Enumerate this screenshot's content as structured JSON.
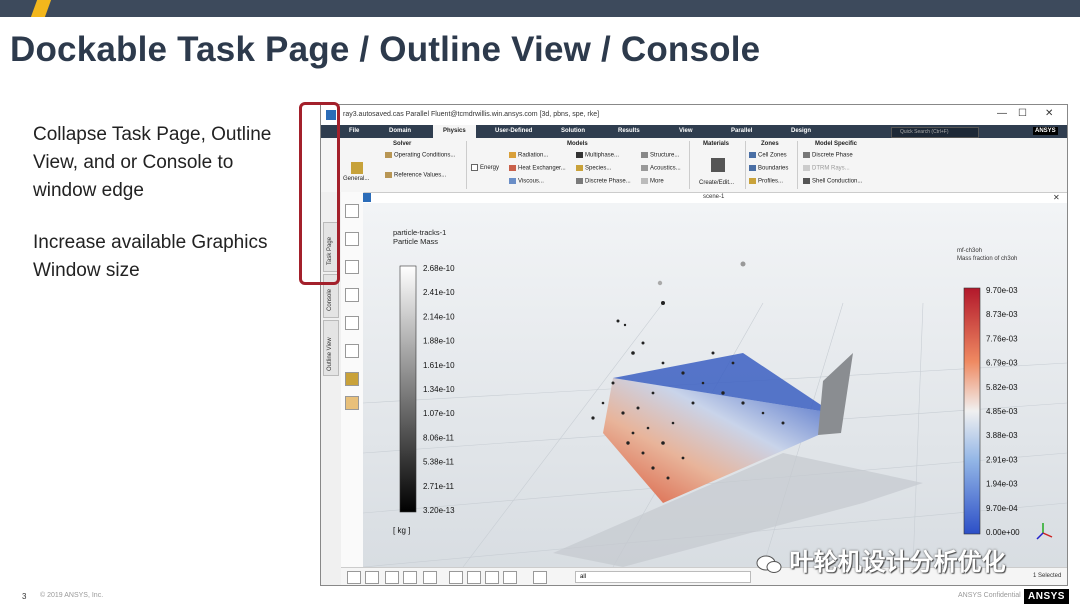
{
  "slide": {
    "title": "Dockable Task Page / Outline View / Console",
    "bullets": [
      "Collapse Task Page, Outline View, and or Console to window edge",
      "Increase available Graphics Window size"
    ],
    "page_number": "3",
    "copyright": "© 2019 ANSYS, Inc.",
    "confidential": "ANSYS Confidential",
    "logo_text": "ANSYS",
    "watermark": "叶轮机设计分析优化"
  },
  "window": {
    "title": "ray3.autosaved.cas Parallel Fluent@tcmdrwillis.win.ansys.com  [3d, pbns, spe, rke]",
    "controls": {
      "min": "—",
      "max": "☐",
      "close": "✕"
    }
  },
  "ribbon_tabs": [
    "File",
    "Domain",
    "Physics",
    "User-Defined",
    "Solution",
    "Results",
    "View",
    "Parallel",
    "Design"
  ],
  "active_tab": "Physics",
  "quick_search": "Quick Search (Ctrl+F)",
  "ribbon": {
    "solver": {
      "title": "Solver",
      "general": "General...",
      "operating": "Operating Conditions...",
      "reference": "Reference Values..."
    },
    "models": {
      "title": "Models",
      "energy": "Energy",
      "radiation": "Radiation...",
      "heat_exchanger": "Heat Exchanger...",
      "viscous": "Viscous...",
      "multiphase": "Multiphase...",
      "species": "Species...",
      "discrete_phase": "Discrete Phase...",
      "structure": "Structure...",
      "acoustics": "Acoustics...",
      "more": "More"
    },
    "materials": {
      "title": "Materials",
      "create_edit": "Create/Edit..."
    },
    "zones": {
      "title": "Zones",
      "cell_zones": "Cell Zones",
      "boundaries": "Boundaries",
      "profiles": "Profiles..."
    },
    "model_specific": {
      "title": "Model Specific",
      "discrete_phase": "Discrete Phase",
      "dtrm_rays": "DTRM Rays...",
      "shell_conduction": "Shell Conduction..."
    }
  },
  "dock_tabs": [
    "Task Page",
    "Console",
    "Outline View"
  ],
  "graphics": {
    "window_label": "scene-1",
    "left_legend": {
      "title1": "particle-tracks-1",
      "title2": "Particle Mass",
      "values": [
        "2.68e-10",
        "2.41e-10",
        "2.14e-10",
        "1.88e-10",
        "1.61e-10",
        "1.34e-10",
        "1.07e-10",
        "8.06e-11",
        "5.38e-11",
        "2.71e-11",
        "3.20e-13"
      ],
      "unit": "[ kg ]"
    },
    "right_legend": {
      "title1": "mf-ch3oh",
      "title2": "Mass fraction of ch3oh",
      "values": [
        "9.70e-03",
        "8.73e-03",
        "7.76e-03",
        "6.79e-03",
        "5.82e-03",
        "4.85e-03",
        "3.88e-03",
        "2.91e-03",
        "1.94e-03",
        "9.70e-04",
        "0.00e+00"
      ]
    },
    "status": "1 Selected",
    "filter_text": "all"
  },
  "colors": {
    "header": "#3d4a5c",
    "accent": "#f3b71c",
    "highlight": "#a3202b",
    "ribbon_bg": "#2f3d4f"
  }
}
